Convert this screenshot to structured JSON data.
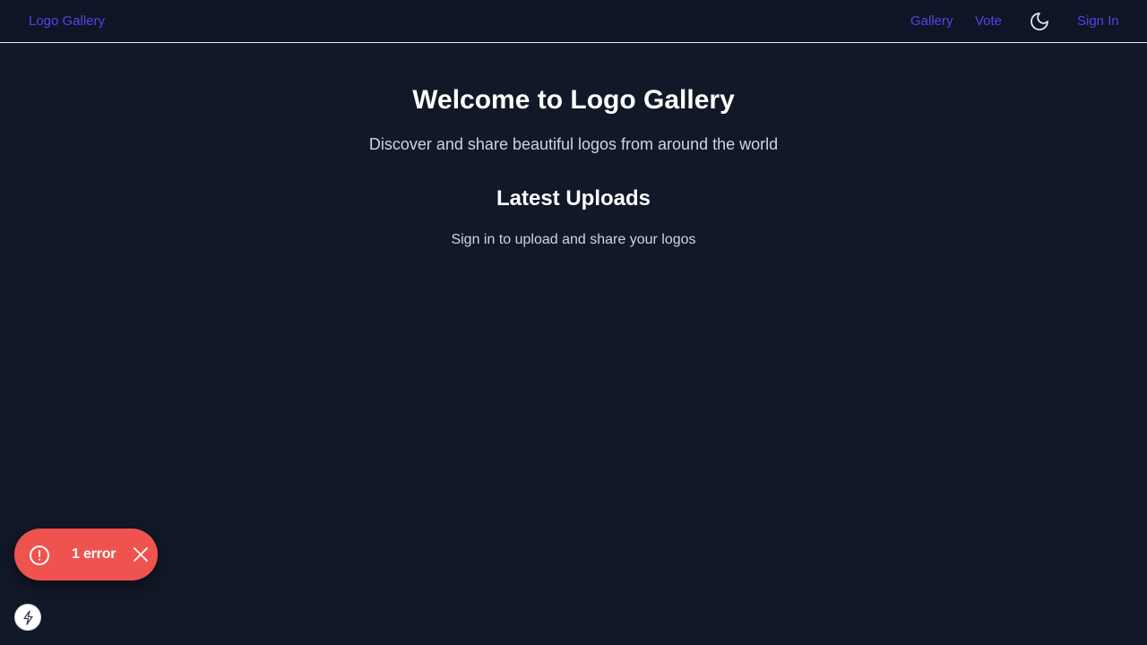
{
  "header": {
    "brand": "Logo Gallery",
    "nav": {
      "gallery": "Gallery",
      "vote": "Vote",
      "sign_in": "Sign In"
    },
    "theme_toggle_icon": "moon-icon"
  },
  "main": {
    "title": "Welcome to Logo Gallery",
    "subtitle": "Discover and share beautiful logos from around the world",
    "latest_heading": "Latest Uploads",
    "latest_note": "Sign in to upload and share your logos"
  },
  "error_toast": {
    "label": "1 error",
    "icon": "alert-circle-icon",
    "close_icon": "close-icon"
  },
  "devtools": {
    "icon": "lightning-icon"
  },
  "colors": {
    "background": "#111827",
    "header_background": "#0f1526",
    "link": "#4f46e5",
    "error": "#ef5350"
  }
}
